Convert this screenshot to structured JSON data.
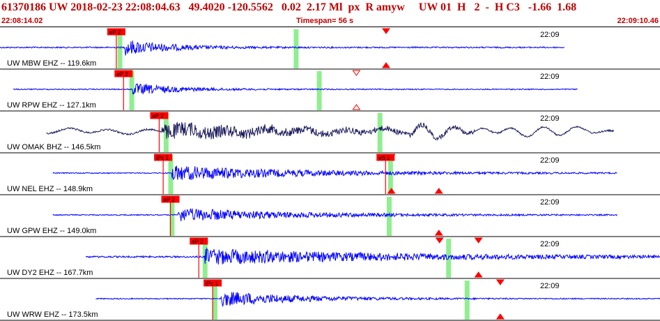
{
  "header": {
    "title": "61370186 UW 2018-02-23 22:08:04.63   49.4020 -120.5562   0.02  2.17 Ml  px  R amyw     UW 01  H   2  -  H C3   -1.66  1.68",
    "start_time": "22:08:14.02",
    "timespan": "Timespan=  56 s",
    "end_time": "22:09:10.46"
  },
  "colors": {
    "trace": "#0000ff",
    "trace_dark": "#1c1c5c",
    "pick_bg": "#ff0000",
    "pick_text": "#000000",
    "green_bar": "#90ee90",
    "marker": "#ff0000",
    "separator": "#000000"
  },
  "time_label": "22:09",
  "traces": [
    {
      "label": "UW MBW EHZ --  119.6km",
      "color": "#0000ff",
      "start": 0.0,
      "end": 0.855,
      "onset": 0.19,
      "amp": 0.45,
      "decay": 0.07,
      "noise": 0.04,
      "picks": [
        {
          "label": "eP 2",
          "x": 0.172
        }
      ],
      "green": [
        0.178,
        0.445
      ],
      "markers": [
        {
          "x": 0.585,
          "pos": "top",
          "filled": true
        },
        {
          "x": 0.585,
          "pos": "bottom",
          "filled": true
        }
      ]
    },
    {
      "label": "UW RPW EHZ --  127.1km",
      "color": "#0000ff",
      "start": 0.02,
      "end": 0.875,
      "onset": 0.2,
      "amp": 0.35,
      "decay": 0.07,
      "noise": 0.03,
      "picks": [
        {
          "label": "eP 2",
          "x": 0.183
        }
      ],
      "green": [
        0.196,
        0.48
      ],
      "markers": [
        {
          "x": 0.54,
          "pos": "top",
          "filled": false
        },
        {
          "x": 0.54,
          "pos": "bottom",
          "filled": false
        }
      ]
    },
    {
      "label": "UW OMAK BHZ --  146.5km",
      "color": "#1c1c5c",
      "start": 0.07,
      "end": 0.93,
      "onset": 0.245,
      "amp": 0.45,
      "decay": 0.25,
      "noise": 0.05,
      "longperiod": true,
      "picks": [
        {
          "label": "eP 2",
          "x": 0.237
        }
      ],
      "green": [
        0.248,
        0.572
      ],
      "markers": []
    },
    {
      "label": "UW NEL EHZ --  148.9km",
      "color": "#0000ff",
      "start": 0.08,
      "end": 0.935,
      "onset": 0.26,
      "amp": 0.45,
      "decay": 0.2,
      "noise": 0.03,
      "picks": [
        {
          "label": "iPc 1",
          "x": 0.243
        },
        {
          "label": "eS 2",
          "x": 0.58
        }
      ],
      "green": [
        0.255,
        0.588
      ],
      "markers": [
        {
          "x": 0.593,
          "pos": "top",
          "filled": true
        },
        {
          "x": 0.593,
          "pos": "bottom",
          "filled": true
        },
        {
          "x": 0.665,
          "pos": "bottom",
          "filled": true
        }
      ]
    },
    {
      "label": "UW GPW EHZ --  149.0km",
      "color": "#0000ff",
      "start": 0.08,
      "end": 0.935,
      "onset": 0.27,
      "amp": 0.4,
      "decay": 0.18,
      "noise": 0.03,
      "picks": [
        {
          "label": "eP 2",
          "x": 0.254
        }
      ],
      "green": [
        0.257,
        0.586
      ],
      "markers": [
        {
          "x": 0.665,
          "pos": "bottom",
          "filled": true
        }
      ]
    },
    {
      "label": "UW DY2 EHZ --  167.7km",
      "color": "#0000ff",
      "start": 0.13,
      "end": 1.0,
      "onset": 0.31,
      "amp": 0.45,
      "decay": 0.3,
      "noise": 0.05,
      "picks": [
        {
          "label": "eP 2",
          "x": 0.297
        }
      ],
      "green": [
        0.307,
        0.676
      ],
      "markers": [
        {
          "x": 0.666,
          "pos": "top",
          "filled": true
        },
        {
          "x": 0.725,
          "pos": "top",
          "filled": true
        },
        {
          "x": 0.725,
          "pos": "bottom",
          "filled": true
        }
      ]
    },
    {
      "label": "UW WRW EHZ --  173.5km",
      "color": "#0000ff",
      "start": 0.145,
      "end": 1.0,
      "onset": 0.335,
      "amp": 0.45,
      "decay": 0.12,
      "noise": 0.03,
      "picks": [
        {
          "label": "iPc 1",
          "x": 0.318
        }
      ],
      "green": [
        0.322,
        0.704
      ],
      "markers": [
        {
          "x": 0.758,
          "pos": "top",
          "filled": true
        },
        {
          "x": 0.758,
          "pos": "bottom",
          "filled": true
        }
      ]
    }
  ]
}
